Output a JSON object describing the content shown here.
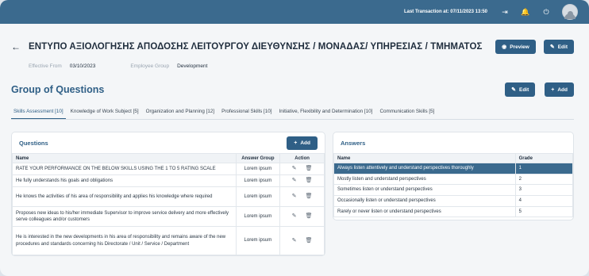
{
  "topbar": {
    "last_transaction": "Last Transaction at: 07/11/2023 13:50",
    "icons": [
      "sign-in-icon",
      "bell-icon",
      "power-icon",
      "user-avatar"
    ]
  },
  "header": {
    "title": "ΕΝΤΥΠΟ  ΑΞΙΟΛΟΓΗΣΗΣ ΑΠΟΔΟΣΗΣ ΛΕΙΤΟΥΡΓΟΥ ΔΙΕΥΘΥΝΣΗΣ / ΜΟΝΑΔΑΣ/ ΥΠΗΡΕΣΙΑΣ / ΤΜΗΜΑΤΟΣ",
    "preview_label": "Preview",
    "edit_label": "Edit"
  },
  "meta": {
    "effective_from_label": "Effective From",
    "effective_from_value": "03/10/2023",
    "employee_group_label": "Employee Group",
    "employee_group_value": "Development"
  },
  "section": {
    "title": "Group of Questions",
    "edit_label": "Edit",
    "add_label": "Add"
  },
  "tabs": [
    {
      "label": "Skills Assessment [10]",
      "active": true
    },
    {
      "label": "Knowledge of Work Subject [5]"
    },
    {
      "label": "Organization and Planning [12]"
    },
    {
      "label": "Professional Skills [10]"
    },
    {
      "label": "Initiative, Flexibility and Determination [10]"
    },
    {
      "label": "Communication Skills [5]"
    }
  ],
  "questions": {
    "title": "Questions",
    "add_label": "Add",
    "columns": [
      "Name",
      "Answer Group",
      "Action"
    ],
    "rows": [
      {
        "name": "RATE YOUR PERFORMANCE ON THE BELOW SKILLS USING THE 1 TO 5 RATING SCALE",
        "group": "Lorem ipsum"
      },
      {
        "name": "He fully understands his goals and obligations",
        "group": "Lorem ipsum"
      },
      {
        "name": "He knows the activities of his area of responsibility and applies his knowledge where required",
        "group": "Lorem ipsum"
      },
      {
        "name": "Proposes new ideas to his/her immediate Supervisor to improve service delivery and more effectively serve colleagues and/or customers",
        "group": "Lorem ipsum"
      },
      {
        "name": "He is interested in the new developments in his area of responsibility and remains aware of the new procedures and standards concerning his Directorate / Unit / Service / Department",
        "group": "Lorem ipsum"
      }
    ]
  },
  "answers": {
    "title": "Answers",
    "columns": [
      "Name",
      "Grade"
    ],
    "rows": [
      {
        "name": "Always listen attentively and understand perspectives thoroughly",
        "grade": "1"
      },
      {
        "name": "Mostly listen and understand perspectives",
        "grade": "2"
      },
      {
        "name": "Sometimes listen or understand perspectives",
        "grade": "3"
      },
      {
        "name": "Occasionally listen or understand perspectives",
        "grade": "4"
      },
      {
        "name": "Rarely or never listen or understand perspectives",
        "grade": "5"
      }
    ]
  },
  "colors": {
    "primary": "#2f5f86",
    "topbar": "#3b6a8e",
    "selected_row": "#3b6a8e"
  }
}
